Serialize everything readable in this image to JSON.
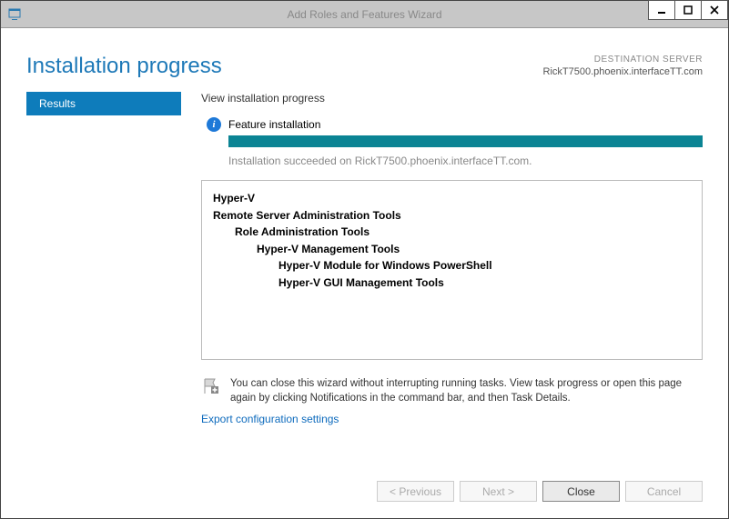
{
  "titlebar": {
    "title": "Add Roles and Features Wizard"
  },
  "header": {
    "page_title": "Installation progress",
    "dest_label": "DESTINATION SERVER",
    "dest_server": "RickT7500.phoenix.interfaceTT.com"
  },
  "sidebar": {
    "step_results": "Results"
  },
  "main": {
    "view_label": "View installation progress",
    "feature_label": "Feature installation",
    "status_text": "Installation succeeded on RickT7500.phoenix.interfaceTT.com.",
    "features": {
      "l0a": "Hyper-V",
      "l0b": "Remote Server Administration Tools",
      "l1a": "Role Administration Tools",
      "l2a": "Hyper-V Management Tools",
      "l3a": "Hyper-V Module for Windows PowerShell",
      "l3b": "Hyper-V GUI Management Tools"
    },
    "notice": "You can close this wizard without interrupting running tasks. View task progress or open this page again by clicking Notifications in the command bar, and then Task Details.",
    "export_link": "Export configuration settings"
  },
  "buttons": {
    "previous": "< Previous",
    "next": "Next >",
    "close": "Close",
    "cancel": "Cancel"
  },
  "progress_percent": 100
}
